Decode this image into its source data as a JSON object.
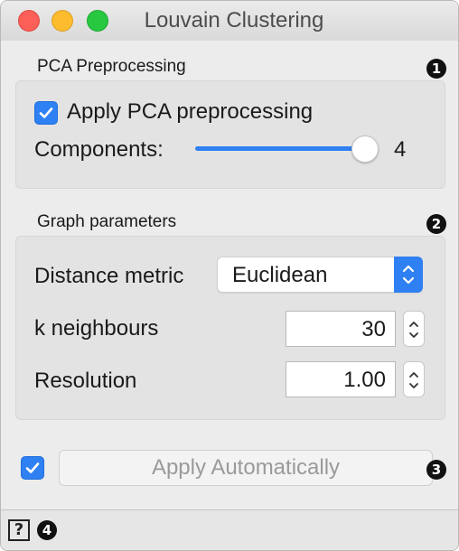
{
  "window": {
    "title": "Louvain Clustering"
  },
  "pca": {
    "group_title": "PCA Preprocessing",
    "badge": "1",
    "apply_label": "Apply PCA preprocessing",
    "apply_checked": true,
    "components_label": "Components:",
    "components_value": "4",
    "slider_fraction": 1.0
  },
  "graph": {
    "group_title": "Graph parameters",
    "badge": "2",
    "distance_label": "Distance metric",
    "distance_value": "Euclidean",
    "k_label": "k neighbours",
    "k_value": "30",
    "resolution_label": "Resolution",
    "resolution_value": "1.00"
  },
  "commit": {
    "badge": "3",
    "auto_checked": true,
    "button_label": "Apply Automatically"
  },
  "status": {
    "help_glyph": "?",
    "badge": "4"
  },
  "colors": {
    "accent": "#2f80f2",
    "close": "#fc5f57",
    "minimize": "#fdbc2e",
    "maximize": "#28c840"
  }
}
